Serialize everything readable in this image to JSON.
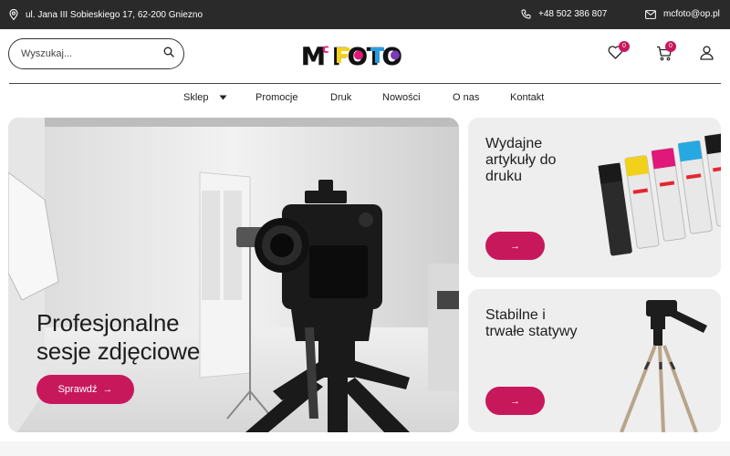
{
  "topbar": {
    "address": "ul. Jana III Sobieskiego 17, 62-200 Gniezno",
    "phone": "+48 502 386 807",
    "email": "mcfoto@op.pl"
  },
  "search": {
    "placeholder": "Wyszukaj..."
  },
  "logo": {
    "part1": "M",
    "part2": "c",
    "part3": "FOTO"
  },
  "header": {
    "wishlist_count": "0",
    "cart_count": "0"
  },
  "nav": {
    "items": [
      {
        "label": "Sklep"
      },
      {
        "label": "Promocje"
      },
      {
        "label": "Druk"
      },
      {
        "label": "Nowości"
      },
      {
        "label": "O nas"
      },
      {
        "label": "Kontakt"
      }
    ]
  },
  "hero": {
    "title": "Profesjonalne\nsesje zdjęciowe",
    "button_label": "Sprawdź",
    "arrow": "→"
  },
  "card_printing": {
    "title": "Wydajne\nartykuły do\ndruku",
    "arrow": "→"
  },
  "card_tripods": {
    "title": "Stabilne i\ntrwałe statywy",
    "arrow": "→"
  },
  "colors": {
    "accent": "#c8185c",
    "topbar": "#2a2a2a"
  }
}
